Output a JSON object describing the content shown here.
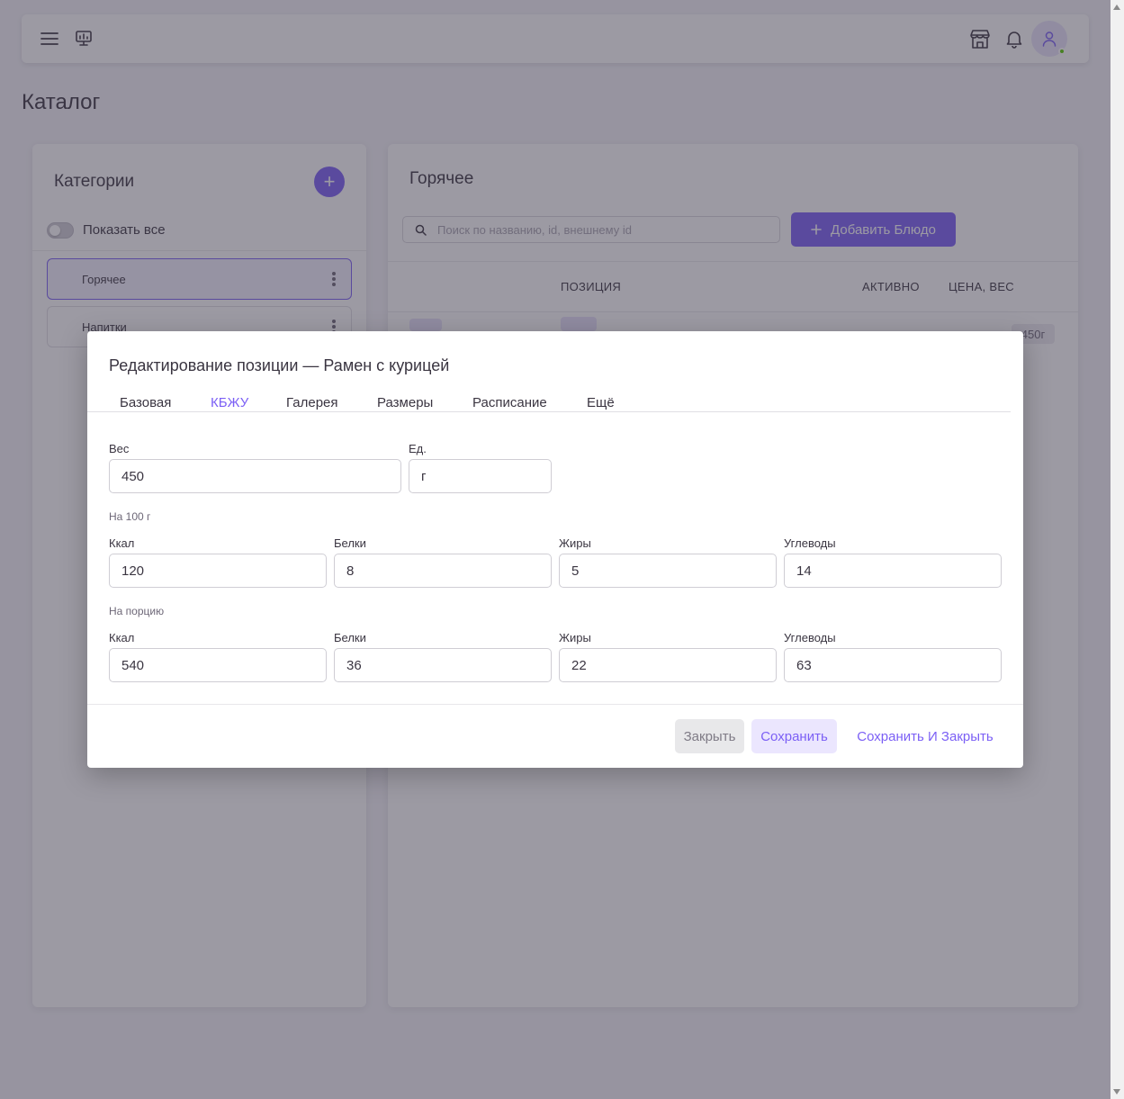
{
  "page": {
    "title": "Каталог"
  },
  "categories": {
    "title": "Категории",
    "add_label": "+",
    "show_all_label": "Показать все",
    "show_all_on": false,
    "items": [
      {
        "label": "Горячее",
        "active": true
      },
      {
        "label": "Напитки",
        "active": false
      }
    ]
  },
  "items": {
    "title": "Горячее",
    "search_placeholder": "Поиск по названию, id, внешнему id",
    "add_button_label": "Добавить Блюдо",
    "columns": [
      "ПОЗИЦИЯ",
      "АКТИВНО",
      "ЦЕНА, ВЕС"
    ],
    "rows": [
      {
        "weight": "450г"
      }
    ]
  },
  "modal": {
    "title": "Редактирование позиции — Рамен с курицей",
    "tabs": [
      {
        "label": "Базовая",
        "active": false
      },
      {
        "label": "КБЖУ",
        "active": true
      },
      {
        "label": "Галерея",
        "active": false
      },
      {
        "label": "Размеры",
        "active": false
      },
      {
        "label": "Расписание",
        "active": false
      },
      {
        "label": "Ещё",
        "active": false
      }
    ],
    "weight": {
      "label": "Вес",
      "value": "450"
    },
    "unit": {
      "label": "Ед.",
      "value": "г"
    },
    "per100": {
      "title": "На 100 г",
      "kcal": {
        "label": "Ккал",
        "value": "120"
      },
      "protein": {
        "label": "Белки",
        "value": "8"
      },
      "fat": {
        "label": "Жиры",
        "value": "5"
      },
      "carbs": {
        "label": "Углеводы",
        "value": "14"
      }
    },
    "portion": {
      "title": "На порцию",
      "kcal": {
        "label": "Ккал",
        "value": "540"
      },
      "protein": {
        "label": "Белки",
        "value": "36"
      },
      "fat": {
        "label": "Жиры",
        "value": "22"
      },
      "carbs": {
        "label": "Углеводы",
        "value": "63"
      }
    },
    "buttons": {
      "close": "Закрыть",
      "save": "Сохранить",
      "save_close": "Сохранить И Закрыть"
    }
  },
  "colors": {
    "accent": "#7b5ff5",
    "status_online": "#56ca00"
  }
}
